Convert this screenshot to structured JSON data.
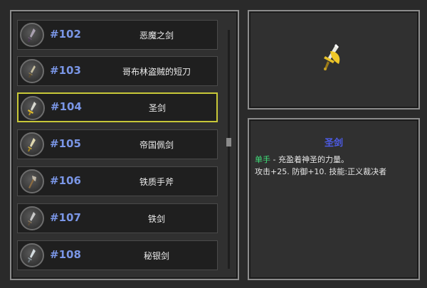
{
  "items": [
    {
      "id": "#102",
      "name": "恶魔之剑",
      "selected": false
    },
    {
      "id": "#103",
      "name": "哥布林盗贼的短刀",
      "selected": false
    },
    {
      "id": "#104",
      "name": "圣剑",
      "selected": true
    },
    {
      "id": "#105",
      "name": "帝国佩剑",
      "selected": false
    },
    {
      "id": "#106",
      "name": "铁质手斧",
      "selected": false
    },
    {
      "id": "#107",
      "name": "铁剑",
      "selected": false
    },
    {
      "id": "#108",
      "name": "秘银剑",
      "selected": false
    }
  ],
  "detail": {
    "title": "圣剑",
    "hand_type": "单手",
    "description": " - 充盈着神圣的力量。",
    "stats": "攻击+25. 防御+10. 技能:正义裁决者"
  },
  "colors": {
    "selected_border": "#c8c838",
    "id_text": "#7a96e6",
    "title": "#4d5ce8",
    "hand_label": "#3fe07a"
  },
  "icons": {
    "item_icon": "sword-icon",
    "preview": "holy-sword-icon"
  }
}
